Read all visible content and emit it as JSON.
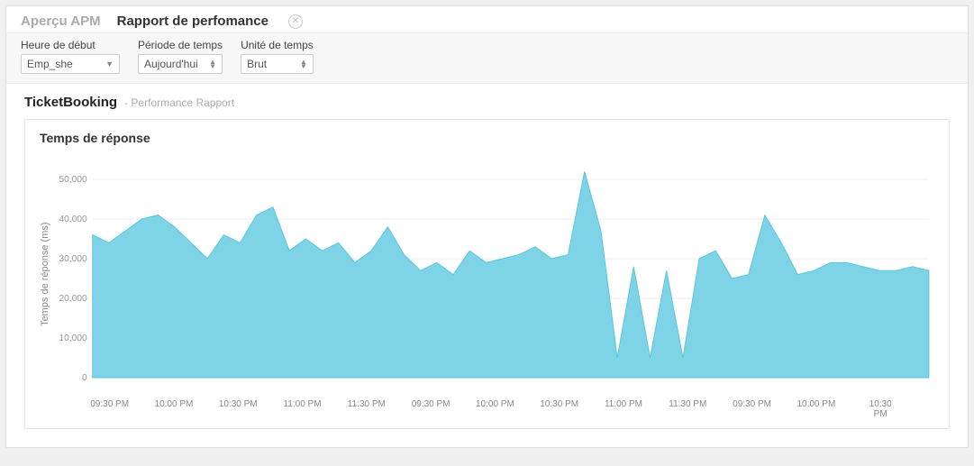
{
  "tabs": {
    "overview": "Aperçu APM",
    "report": "Rapport de perfomance"
  },
  "filters": {
    "start_label": "Heure de début",
    "start_value": "Emp_she",
    "period_label": "Période de temps",
    "period_value": "Aujourd'hui",
    "unit_label": "Unité de temps",
    "unit_value": "Brut"
  },
  "title": {
    "app": "TicketBooking",
    "sub": "- Performance Rapport"
  },
  "chart_data": {
    "type": "area",
    "title": "Temps de réponse",
    "ylabel": "Temps de réponse (ms)",
    "ylim": [
      0,
      55000
    ],
    "y_ticks": [
      0,
      10000,
      20000,
      30000,
      40000,
      50000
    ],
    "y_tick_labels": [
      "0",
      "10,000",
      "20,000",
      "30,000",
      "40,000",
      "50,000"
    ],
    "x_labels": [
      "09:30 PM",
      "10:00 PM",
      "10:30 PM",
      "11:00 PM",
      "11:30 PM",
      "09:30 PM",
      "10:00 PM",
      "10:30 PM",
      "11:00 PM",
      "11:30 PM",
      "09:30 PM",
      "10:00 PM",
      "10:30 PM"
    ],
    "values": [
      36000,
      34000,
      37000,
      40000,
      41000,
      38000,
      34000,
      30000,
      36000,
      34000,
      41000,
      43000,
      32000,
      35000,
      32000,
      34000,
      29000,
      32000,
      38000,
      31000,
      27000,
      29000,
      26000,
      32000,
      29000,
      30000,
      31000,
      33000,
      30000,
      31000,
      52000,
      37000,
      5000,
      28000,
      5000,
      27000,
      5000,
      30000,
      32000,
      25000,
      26000,
      41000,
      34000,
      26000,
      27000,
      29000,
      29000,
      28000,
      27000,
      27000,
      28000,
      27000
    ]
  }
}
